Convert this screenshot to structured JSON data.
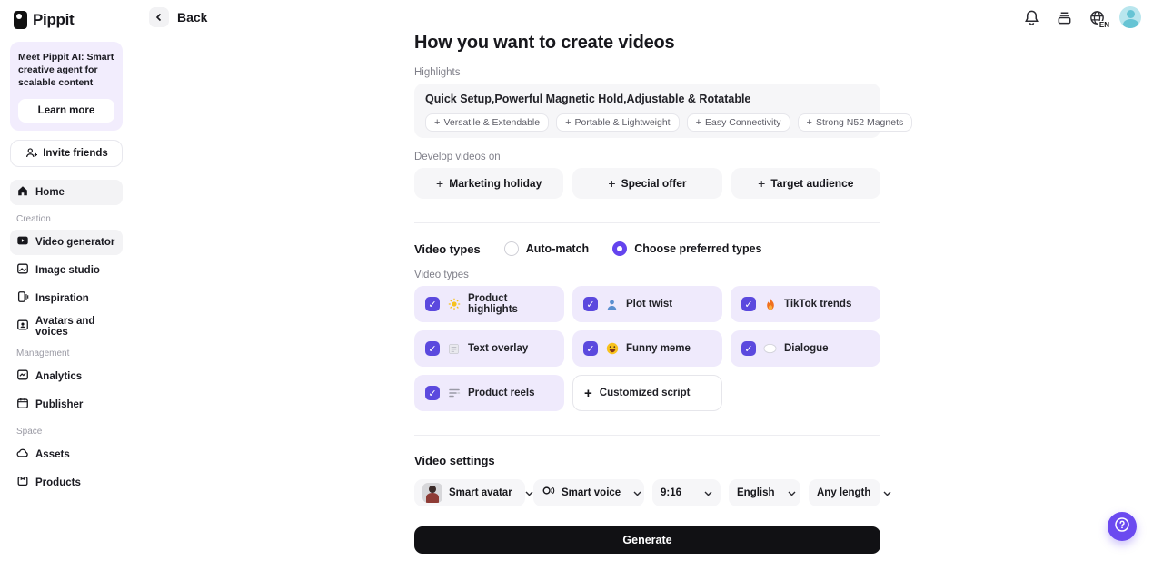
{
  "colors": {
    "accent": "#6444ee",
    "checkbox_purple": "#5b49de",
    "card_purple": "#efeafc",
    "promo_purple": "#f2edfd",
    "gray_surface": "#f6f6f8",
    "generate_black": "#111114",
    "muted_text": "#80808a"
  },
  "brand": {
    "name": "Pippit",
    "logo_icon": "pippit-logo"
  },
  "topbar": {
    "back_label": "Back",
    "back_icon": "chevron-left-icon",
    "notifications_icon": "bell-icon",
    "tasks_icon": "inbox-icon",
    "language_icon": "globe-icon",
    "language_badge": "EN",
    "avatar": "user-avatar"
  },
  "sidebar": {
    "promo": {
      "text": "Meet Pippit AI: Smart creative agent for scalable content",
      "button": "Learn more"
    },
    "invite_button": {
      "label": "Invite friends",
      "icon": "person-plus-icon"
    },
    "home": {
      "label": "Home",
      "icon": "home-icon",
      "active": true
    },
    "sections": [
      {
        "title": "Creation",
        "items": [
          {
            "label": "Video generator",
            "icon": "video-icon",
            "active": true
          },
          {
            "label": "Image studio",
            "icon": "image-icon",
            "active": false
          },
          {
            "label": "Inspiration",
            "icon": "inspiration-icon",
            "active": false
          },
          {
            "label": "Avatars and voices",
            "icon": "avatar-card-icon",
            "active": false
          }
        ]
      },
      {
        "title": "Management",
        "items": [
          {
            "label": "Analytics",
            "icon": "analytics-icon",
            "active": false
          },
          {
            "label": "Publisher",
            "icon": "calendar-icon",
            "active": false
          }
        ]
      },
      {
        "title": "Space",
        "items": [
          {
            "label": "Assets",
            "icon": "cloud-icon",
            "active": false
          },
          {
            "label": "Products",
            "icon": "box-icon",
            "active": false
          }
        ]
      }
    ]
  },
  "main": {
    "title": "How you want to create videos",
    "highlights": {
      "label": "Highlights",
      "value": "Quick Setup,Powerful Magnetic Hold,Adjustable & Rotatable",
      "suggestions": [
        "Versatile & Extendable",
        "Portable & Lightweight",
        "Easy Connectivity",
        "Strong N52 Magnets"
      ]
    },
    "develop": {
      "label": "Develop videos on",
      "options": [
        "Marketing holiday",
        "Special offer",
        "Target audience"
      ]
    },
    "video_types": {
      "title": "Video types",
      "radios": [
        {
          "label": "Auto-match",
          "selected": false
        },
        {
          "label": "Choose preferred types",
          "selected": true
        }
      ],
      "sublabel": "Video types",
      "items": [
        {
          "label": "Product highlights",
          "icon": "sun-icon",
          "checked": true
        },
        {
          "label": "Plot twist",
          "icon": "person-icon",
          "checked": true
        },
        {
          "label": "TikTok trends",
          "icon": "flame-icon",
          "checked": true
        },
        {
          "label": "Text overlay",
          "icon": "text-doc-icon",
          "checked": true
        },
        {
          "label": "Funny meme",
          "icon": "smiley-icon",
          "checked": true
        },
        {
          "label": "Dialogue",
          "icon": "speech-oval-icon",
          "checked": true
        },
        {
          "label": "Product reels",
          "icon": "reel-lines-icon",
          "checked": true
        }
      ],
      "custom_option": {
        "label": "Customized script",
        "icon": "plus-icon"
      }
    },
    "settings": {
      "title": "Video settings",
      "dropdowns": [
        {
          "value": "Smart avatar",
          "icon": "avatar-thumbnail"
        },
        {
          "value": "Smart voice",
          "icon": "voice-icon"
        },
        {
          "value": "9:16",
          "icon": null
        },
        {
          "value": "English",
          "icon": null
        },
        {
          "value": "Any length",
          "icon": null
        }
      ]
    },
    "generate_button": "Generate"
  },
  "floating": {
    "help_icon": "question-help-icon"
  }
}
